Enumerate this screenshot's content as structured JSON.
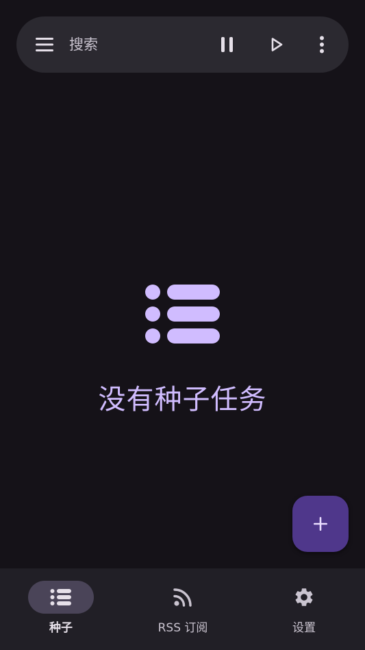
{
  "search": {
    "placeholder": "搜索",
    "icons": {
      "menu": "menu-icon",
      "pause": "pause-icon",
      "resume": "play-icon",
      "more": "more-vert-icon"
    }
  },
  "empty_state": {
    "icon": "list-icon",
    "message": "没有种子任务"
  },
  "fab": {
    "icon": "add-icon"
  },
  "bottom_nav": {
    "items": [
      {
        "label": "种子",
        "icon": "list-icon",
        "active": true
      },
      {
        "label": "RSS 订阅",
        "icon": "rss-icon",
        "active": false
      },
      {
        "label": "设置",
        "icon": "gear-icon",
        "active": false
      }
    ]
  },
  "colors": {
    "background": "#151218",
    "surface": "#2b2930",
    "nav_background": "#211f26",
    "primary": "#d0bcff",
    "fab": "#4f378b",
    "nav_active_pill": "#4a4458",
    "on_surface_variant": "#cac4d0"
  }
}
